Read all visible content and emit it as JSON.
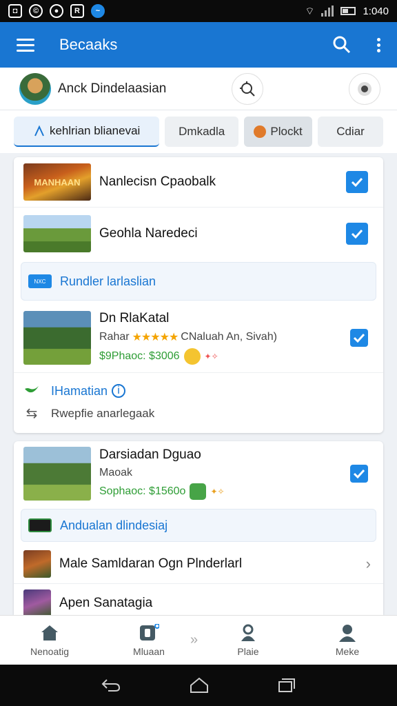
{
  "status_bar": {
    "time": "1:040"
  },
  "app_bar": {
    "title": "Becaaks"
  },
  "profile": {
    "name": "Anck Dindelaasian"
  },
  "tabs": [
    {
      "label": "kehlrian blianevai"
    },
    {
      "label": "Dmkadla"
    },
    {
      "label": "Plockt"
    },
    {
      "label": "Cdiar"
    }
  ],
  "card1": {
    "items": [
      {
        "title": "Nanlecisn Cpaobalk",
        "thumb_text": "MANHAAN"
      },
      {
        "title": "Geohla Naredeci"
      }
    ],
    "section": {
      "icon_text": "NXC",
      "label": "Rundler larlaslian"
    },
    "detail": {
      "title": "Dn RlaKatal",
      "sub_prefix": "Rahar",
      "stars": "★★★★★",
      "sub_suffix": "CNaluah An, Sivah)",
      "price": "$9Phaoc: $3006"
    },
    "info": {
      "title": "IHamatian",
      "sub": "Rwepfie anarlegaak"
    }
  },
  "card2": {
    "detail": {
      "title": "Darsiadan Dguao",
      "sub": "Maoak",
      "price": "Sophaoc: $1560o"
    },
    "section": {
      "label": "Andualan dlindesiaj"
    },
    "items": [
      {
        "title": "Male Samldaran Ogn Plnderlarl"
      },
      {
        "title": "Apen Sanatagia"
      }
    ]
  },
  "bottom_nav": [
    {
      "label": "Nenoatig",
      "icon": "home-icon"
    },
    {
      "label": "Mluaan",
      "icon": "device-icon"
    },
    {
      "label": "Plaie",
      "icon": "user-badge-icon"
    },
    {
      "label": "Meke",
      "icon": "person-icon"
    }
  ],
  "colors": {
    "primary": "#1976d2",
    "accent": "#1e88e5",
    "price_green": "#2e9d35",
    "star": "#f4a400"
  }
}
